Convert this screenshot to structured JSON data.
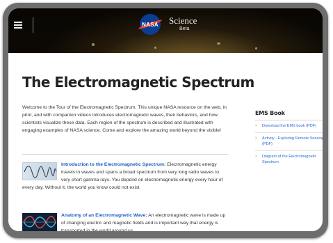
{
  "header": {
    "logo_text": "NASA",
    "site_title": "Science",
    "site_badge": "Beta"
  },
  "main": {
    "title": "The Electromagnetic Spectrum",
    "intro": "Welcome to the Tour of the Electromagnetic Spectrum. This unique NASA resource on the web, in print, and with companion videos introduces electromagnetic waves, their behaviors, and how scientists visualize these data. Each region of the spectrum is described and illustrated with engaging examples of NASA science. Come and explore the amazing world beyond the visible!",
    "entries": [
      {
        "title": "Introduction to the Electromagnetic Spectrum:",
        "text": "Electromagnetic energy travels in waves and spans a broad spectrum from very long radio waves to very short gamma rays. You depend on electromagnetic energy every hour of every day. Without it, the world you know could not exist."
      },
      {
        "title": "Anatomy of an Electromagnetic Wave:",
        "text": "An electromagnetic wave is made up of changing electric and magnetic fields and is important way that energy is transported in the world around us."
      }
    ]
  },
  "sidebar": {
    "title": "EMS Book",
    "items": [
      {
        "label": "Download the EMS book (PDF)"
      },
      {
        "label": "Activity - Exploring Remote Sensing (PDF)"
      },
      {
        "label": "Diagram of the Electromagnetic Spectrum"
      }
    ]
  },
  "icons": {
    "menu": "hamburger-menu-icon",
    "bullet": "chevron-right-icon"
  },
  "colors": {
    "link": "#1a5fbf",
    "bullet": "#e6a51c",
    "nasa_blue": "#0b3d91",
    "nasa_red": "#fc3d21"
  }
}
